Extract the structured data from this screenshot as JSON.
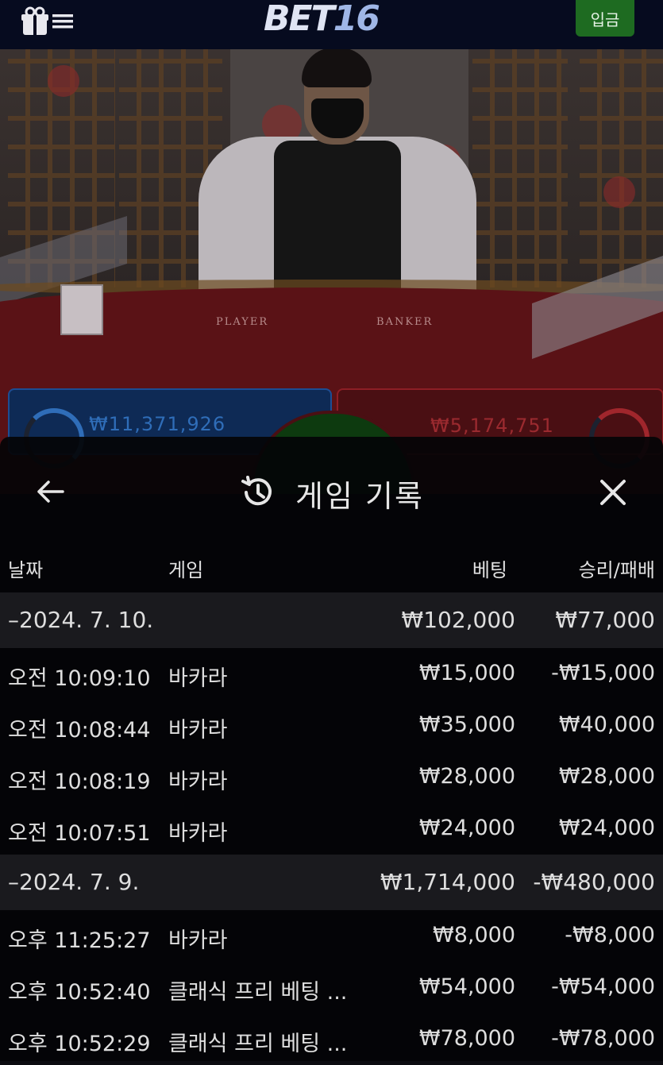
{
  "header": {
    "logo_text": "BET",
    "logo_num": "16",
    "deposit_label": "입금",
    "icons": [
      "gift-icon",
      "hamburger-menu-icon"
    ]
  },
  "game_bg": {
    "felt_player": "PLAYER",
    "felt_banker": "BANKER",
    "player_total": "₩11,371,926",
    "banker_total": "₩5,174,751"
  },
  "modal": {
    "title": "게임 기록",
    "icons": [
      "back-arrow-icon",
      "history-icon",
      "close-icon"
    ],
    "columns": {
      "date": "날짜",
      "game": "게임",
      "bet": "베팅",
      "win_loss": "승리/패배"
    },
    "groups": [
      {
        "date": "–2024. 7. 10.",
        "bet_total": "₩102,000",
        "win_loss_total": "₩77,000",
        "rows": [
          {
            "time": "오전 10:09:10",
            "game": "바카라",
            "bet": "₩15,000",
            "win_loss": "-₩15,000"
          },
          {
            "time": "오전 10:08:44",
            "game": "바카라",
            "bet": "₩35,000",
            "win_loss": "₩40,000"
          },
          {
            "time": "오전 10:08:19",
            "game": "바카라",
            "bet": "₩28,000",
            "win_loss": "₩28,000"
          },
          {
            "time": "오전 10:07:51",
            "game": "바카라",
            "bet": "₩24,000",
            "win_loss": "₩24,000"
          }
        ]
      },
      {
        "date": "–2024. 7. 9.",
        "bet_total": "₩1,714,000",
        "win_loss_total": "-₩480,000",
        "rows": [
          {
            "time": "오후 11:25:27",
            "game": "바카라",
            "bet": "₩8,000",
            "win_loss": "-₩8,000"
          },
          {
            "time": "오후 10:52:40",
            "game": "클래식 프리 베팅 ...",
            "bet": "₩54,000",
            "win_loss": "-₩54,000"
          },
          {
            "time": "오후 10:52:29",
            "game": "클래식 프리 베팅 ...",
            "bet": "₩78,000",
            "win_loss": "-₩78,000"
          }
        ]
      }
    ]
  }
}
